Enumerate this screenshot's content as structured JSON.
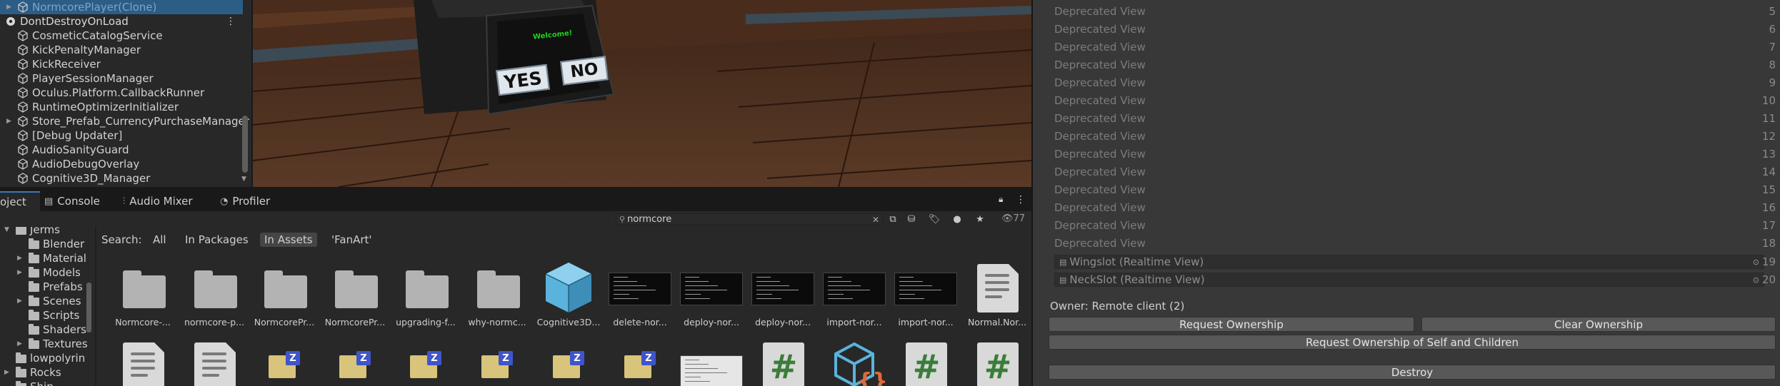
{
  "hierarchy": {
    "items": [
      {
        "label": "NormcorePlayer(Clone)",
        "type": "clone"
      },
      {
        "label": "DontDestroyOnLoad",
        "type": "scene"
      },
      {
        "label": "CosmeticCatalogService"
      },
      {
        "label": "KickPenaltyManager"
      },
      {
        "label": "KickReceiver"
      },
      {
        "label": "PlayerSessionManager"
      },
      {
        "label": "Oculus.Platform.CallbackRunner"
      },
      {
        "label": "RuntimeOptimizerInitializer"
      },
      {
        "label": "Store_Prefab_CurrencyPurchaseManager"
      },
      {
        "label": "[Debug Updater]"
      },
      {
        "label": "AudioSanityGuard"
      },
      {
        "label": "AudioDebugOverlay"
      },
      {
        "label": "Cognitive3D_Manager"
      }
    ]
  },
  "scene": {
    "sign_title": "Welcome!",
    "yes_label": "YES",
    "no_label": "NO"
  },
  "tabs": [
    {
      "label": "oject",
      "icon": "folder-icon",
      "active": true
    },
    {
      "label": "Console",
      "icon": "console-icon"
    },
    {
      "label": "Audio Mixer",
      "icon": "mixer-icon"
    },
    {
      "label": "Profiler",
      "icon": "profiler-icon"
    }
  ],
  "project": {
    "search_value": "normcore",
    "hidden_count": "77",
    "tree": [
      {
        "label": "Jerms",
        "depth": 0,
        "arrow": true
      },
      {
        "label": "Blender",
        "depth": 1,
        "arrow": false
      },
      {
        "label": "Material",
        "depth": 1,
        "arrow": true
      },
      {
        "label": "Models",
        "depth": 1,
        "arrow": true
      },
      {
        "label": "Prefabs",
        "depth": 1,
        "arrow": false
      },
      {
        "label": "Scenes",
        "depth": 1,
        "arrow": true
      },
      {
        "label": "Scripts",
        "depth": 1,
        "arrow": false
      },
      {
        "label": "Shaders",
        "depth": 1,
        "arrow": false
      },
      {
        "label": "Textures",
        "depth": 1,
        "arrow": true
      },
      {
        "label": "lowpolyrin",
        "depth": 0,
        "arrow": false
      },
      {
        "label": "Rocks",
        "depth": 0,
        "arrow": true
      },
      {
        "label": "Ship",
        "depth": 0,
        "arrow": false
      }
    ],
    "filters": {
      "label": "Search:",
      "all": "All",
      "in_packages": "In Packages",
      "in_assets": "In Assets",
      "fanart": "'FanArt'"
    },
    "assets_row1": [
      {
        "name": "Normcore-...",
        "kind": "folder"
      },
      {
        "name": "normcore-p...",
        "kind": "folder"
      },
      {
        "name": "NormcorePr...",
        "kind": "folder"
      },
      {
        "name": "NormcorePr...",
        "kind": "folder"
      },
      {
        "name": "upgrading-f...",
        "kind": "folder"
      },
      {
        "name": "why-normc...",
        "kind": "folder"
      },
      {
        "name": "Cognitive3D...",
        "kind": "cube"
      },
      {
        "name": "delete-nor...",
        "kind": "shot"
      },
      {
        "name": "deploy-nor...",
        "kind": "shot"
      },
      {
        "name": "deploy-nor...",
        "kind": "shot"
      },
      {
        "name": "import-nor...",
        "kind": "shot"
      },
      {
        "name": "import-nor...",
        "kind": "shot"
      },
      {
        "name": "Normal.Nor...",
        "kind": "doc"
      }
    ],
    "assets_row2": [
      {
        "kind": "doc"
      },
      {
        "kind": "doc"
      },
      {
        "kind": "zip"
      },
      {
        "kind": "zip"
      },
      {
        "kind": "zip"
      },
      {
        "kind": "zip"
      },
      {
        "kind": "zip"
      },
      {
        "kind": "zip"
      },
      {
        "kind": "shot-light"
      },
      {
        "kind": "cs"
      },
      {
        "kind": "cube-code"
      },
      {
        "kind": "cs"
      },
      {
        "kind": "cs"
      }
    ]
  },
  "inspector": {
    "deprecated_label": "Deprecated View",
    "deprecated_numbers": [
      "5",
      "6",
      "7",
      "8",
      "9",
      "10",
      "11",
      "12",
      "13",
      "14",
      "15",
      "16",
      "17",
      "18"
    ],
    "slots": [
      {
        "label": "Wingslot (Realtime View)",
        "index": "19"
      },
      {
        "label": "NeckSlot (Realtime View)",
        "index": "20"
      }
    ],
    "owner": "Owner: Remote client (2)",
    "request_ownership": "Request Ownership",
    "clear_ownership": "Clear Ownership",
    "request_ownership_children": "Request Ownership of Self and Children",
    "destroy": "Destroy"
  },
  "colors": {
    "selection": "#2c5d87",
    "sign_green": "#1fd11f",
    "cube_blue": "#5ab3dd"
  }
}
